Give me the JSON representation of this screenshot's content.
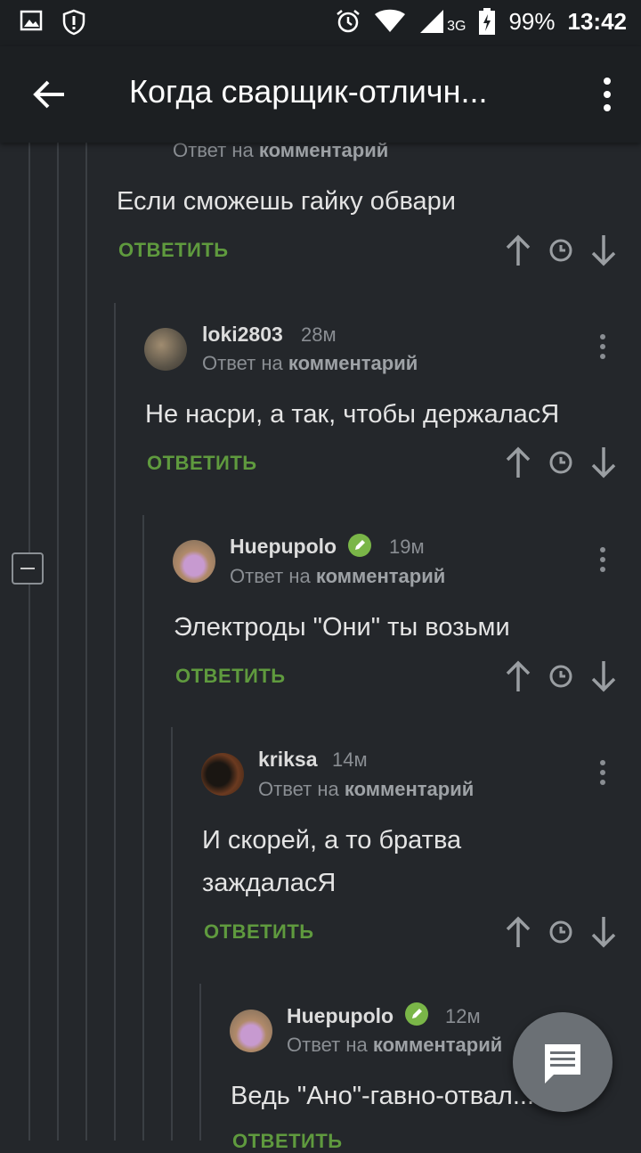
{
  "status_bar": {
    "battery": "99%",
    "time": "13:42",
    "network": "3G"
  },
  "app_bar": {
    "title": "Когда сварщик-отличн..."
  },
  "comments": [
    {
      "reply_prefix": "Ответ на",
      "reply_target": "комментарий",
      "text": "Если сможешь гайку обвари",
      "reply_label": "ОТВЕТИТЬ"
    },
    {
      "username": "loki2803",
      "time": "28м",
      "reply_prefix": "Ответ на",
      "reply_target": "комментарий",
      "text": "Не насри, а так,  чтобы держаласЯ",
      "reply_label": "ОТВЕТИТЬ"
    },
    {
      "username": "Huepupolo",
      "time": "19м",
      "reply_prefix": "Ответ на",
      "reply_target": "комментарий",
      "text": "Электроды \"Они\" ты возьми",
      "reply_label": "ОТВЕТИТЬ"
    },
    {
      "username": "kriksa",
      "time": "14м",
      "reply_prefix": "Ответ на",
      "reply_target": "комментарий",
      "text_line1": "И скорей, а то братва",
      "text_line2": "заждаласЯ",
      "reply_label": "ОТВЕТИТЬ"
    },
    {
      "username": "Huepupolo",
      "time": "12м",
      "reply_prefix": "Ответ на",
      "reply_target": "комментарий",
      "text": "Ведь \"Ано\"-гавно-отвал...",
      "reply_label": "ОТВЕТИТЬ"
    }
  ],
  "colors": {
    "accent_green": "#5f9a3e",
    "background": "#24272b",
    "bar": "#1c1f22"
  }
}
